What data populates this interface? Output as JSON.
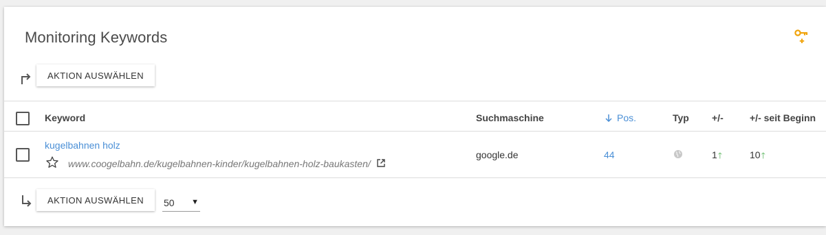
{
  "header": {
    "title": "Monitoring Keywords",
    "key_icon": "key-plus-icon",
    "accent": "#f0a30a"
  },
  "toolbar_top": {
    "action_label": "AKTION AUSWÄHLEN"
  },
  "table": {
    "columns": {
      "keyword": "Keyword",
      "engine": "Suchmaschine",
      "pos": "Pos.",
      "type": "Typ",
      "diff": "+/-",
      "diff_start": "+/- seit Beginn"
    },
    "rows": [
      {
        "keyword": "kugelbahnen holz",
        "url": "www.coogelbahn.de/kugelbahnen-kinder/kugelbahnen-holz-baukasten/",
        "engine": "google.de",
        "pos": "44",
        "diff": "1",
        "diff_start": "10"
      }
    ]
  },
  "toolbar_bottom": {
    "action_label": "AKTION AUSWÄHLEN",
    "page_size": "50"
  },
  "colors": {
    "link": "#4a8fd6",
    "up": "#4caf50"
  }
}
